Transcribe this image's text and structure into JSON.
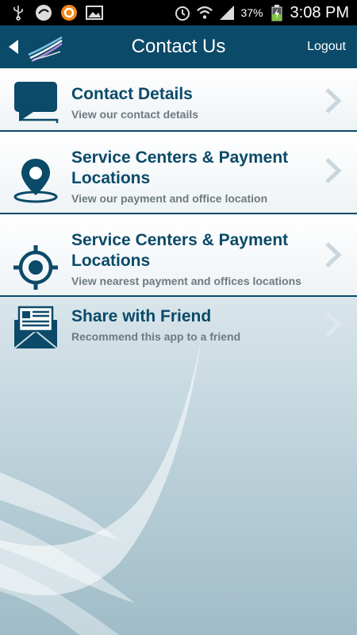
{
  "status_bar": {
    "battery_percent": "37%",
    "time": "3:08 PM",
    "icons": [
      "usb-icon",
      "app-icon-1",
      "app-icon-2",
      "image-icon",
      "alarm-icon",
      "wifi-icon",
      "signal-icon",
      "battery-icon"
    ]
  },
  "header": {
    "title": "Contact Us",
    "logout_label": "Logout",
    "color": "#0b4a68"
  },
  "items": [
    {
      "title": "Contact Details",
      "subtitle": "View our contact details",
      "icon": "chat-bubble-icon"
    },
    {
      "title": "Service Centers & Payment Locations",
      "subtitle": "View our payment and office location",
      "icon": "location-pin-icon"
    },
    {
      "title": "Service Centers & Payment Locations",
      "subtitle": "View nearest payment and offices locations",
      "icon": "crosshair-icon"
    },
    {
      "title": "Share with Friend",
      "subtitle": "Recommend this app to a friend",
      "icon": "envelope-icon"
    }
  ]
}
